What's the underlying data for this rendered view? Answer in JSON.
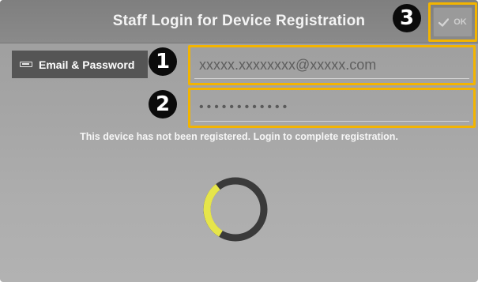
{
  "header": {
    "title": "Staff Login for Device Registration"
  },
  "ok_button": {
    "label": "OK",
    "icon": "check-icon"
  },
  "markers": [
    "1",
    "2",
    "3"
  ],
  "login_tab": {
    "label": "Email & Password",
    "icon": "keyboard-icon"
  },
  "email_field": {
    "value": "xxxxx.xxxxxxxx@xxxxx.com"
  },
  "password_field": {
    "value": "••••••••••••"
  },
  "status": {
    "message": "This device has not been registered. Login to complete registration."
  },
  "spinner": {
    "icon": "loading-spinner-icon",
    "progress_color": "#e6e54a",
    "track_color": "#3a3a3a"
  },
  "colors": {
    "highlight": "#f3b400",
    "header_bg": "#828282",
    "screen_bg": "#a8a8a8"
  }
}
